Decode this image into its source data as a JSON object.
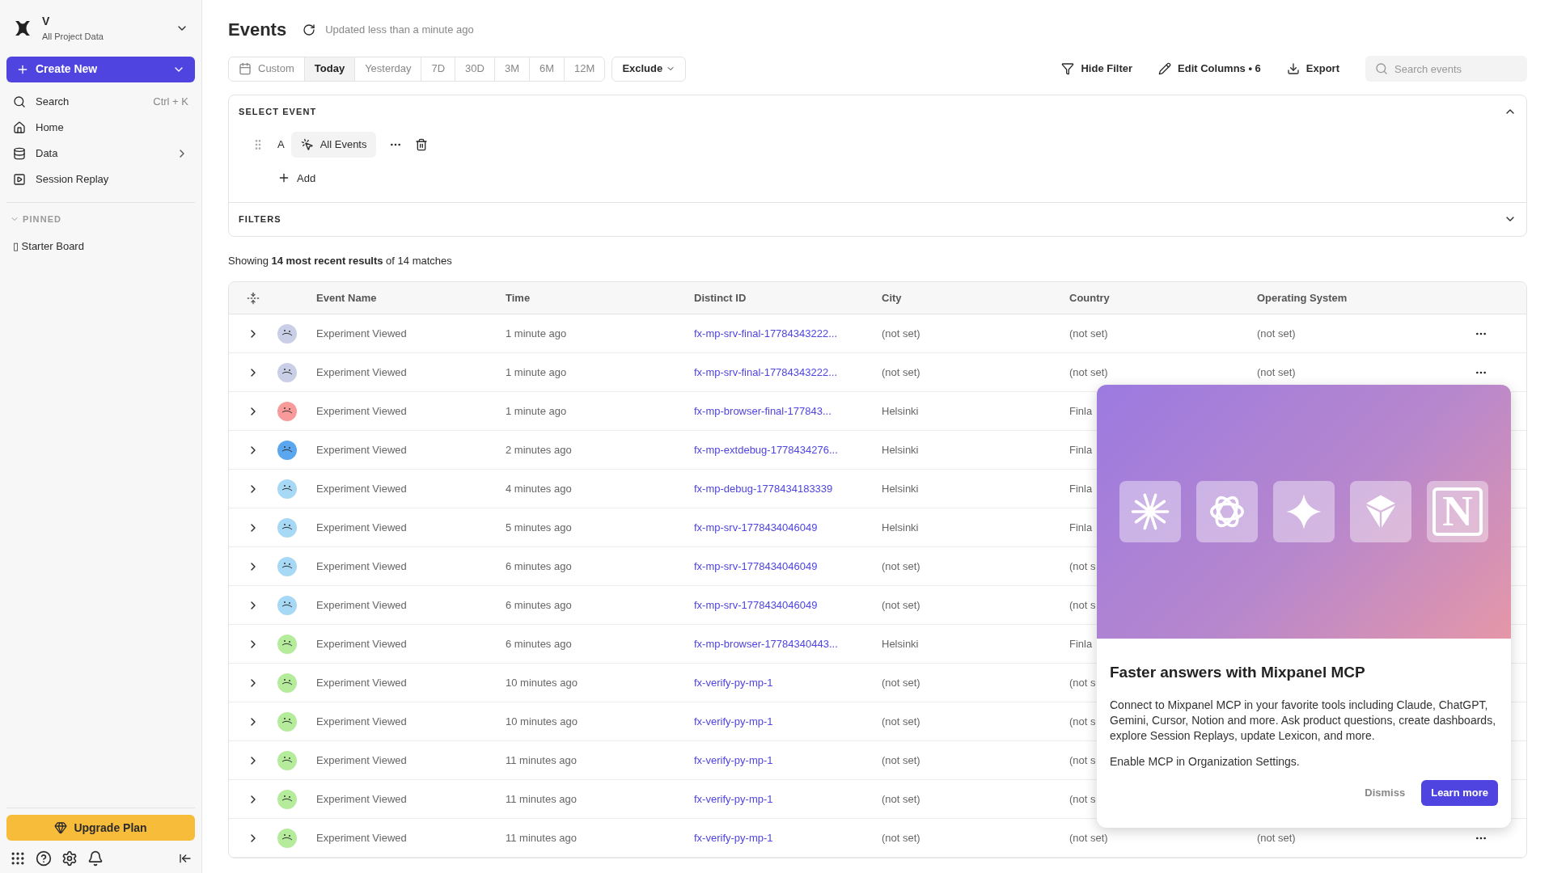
{
  "sidebar": {
    "project": {
      "name": "V",
      "subtitle": "All Project Data"
    },
    "create_button": "Create New",
    "nav": [
      {
        "kind": "search",
        "label": "Search",
        "shortcut": "Ctrl + K"
      },
      {
        "kind": "home",
        "label": "Home"
      },
      {
        "kind": "data",
        "label": "Data"
      },
      {
        "kind": "replay",
        "label": "Session Replay"
      }
    ],
    "pinned_heading": "PINNED",
    "pinned": [
      {
        "label": "▯ Starter Board"
      }
    ],
    "upgrade_button": "Upgrade Plan"
  },
  "header": {
    "title": "Events",
    "updated": "Updated less than a minute ago"
  },
  "range_tabs": [
    {
      "label": "Custom",
      "selected": false
    },
    {
      "label": "Today",
      "selected": true
    },
    {
      "label": "Yesterday",
      "selected": false
    },
    {
      "label": "7D",
      "selected": false
    },
    {
      "label": "30D",
      "selected": false
    },
    {
      "label": "3M",
      "selected": false
    },
    {
      "label": "6M",
      "selected": false
    },
    {
      "label": "12M",
      "selected": false
    }
  ],
  "exclude_button": "Exclude",
  "actions": [
    {
      "kind": "filter",
      "label": "Hide Filter"
    },
    {
      "kind": "edit",
      "label": "Edit Columns • 6"
    },
    {
      "kind": "export",
      "label": "Export"
    }
  ],
  "search": {
    "placeholder": "Search events"
  },
  "select_event": {
    "heading": "SELECT EVENT",
    "expanded": true,
    "letter": "A",
    "event": "All Events",
    "add": "Add"
  },
  "filters": {
    "heading": "FILTERS",
    "expanded": false
  },
  "summary": "Showing **14 most recent results** of 14 matches",
  "table": {
    "columns": [
      "Event Name",
      "Time",
      "Distinct ID",
      "City",
      "Country",
      "Operating System"
    ],
    "rows": [
      {
        "color": "#c9cfe6",
        "event": "Experiment Viewed",
        "time": "1 minute ago",
        "distinct_id": "fx-mp-srv-final-17784343222...",
        "city": "(not set)",
        "country": "(not set)",
        "os": "(not set)",
        "menu": true
      },
      {
        "color": "#c9cfe6",
        "event": "Experiment Viewed",
        "time": "1 minute ago",
        "distinct_id": "fx-mp-srv-final-17784343222...",
        "city": "(not set)",
        "country": "(not set)",
        "os": "(not set)",
        "menu": true
      },
      {
        "color": "#f99a9a",
        "event": "Experiment Viewed",
        "time": "1 minute ago",
        "distinct_id": "fx-mp-browser-final-177843...",
        "city": "Helsinki",
        "country": "Finla"
      },
      {
        "color": "#5aa7f0",
        "event": "Experiment Viewed",
        "time": "2 minutes ago",
        "distinct_id": "fx-mp-extdebug-1778434276...",
        "city": "Helsinki",
        "country": "Finla"
      },
      {
        "color": "#a7d8f5",
        "event": "Experiment Viewed",
        "time": "4 minutes ago",
        "distinct_id": "fx-mp-debug-1778434183339",
        "city": "Helsinki",
        "country": "Finla"
      },
      {
        "color": "#a7d8f5",
        "event": "Experiment Viewed",
        "time": "5 minutes ago",
        "distinct_id": "fx-mp-srv-1778434046049",
        "city": "Helsinki",
        "country": "Finla"
      },
      {
        "color": "#a7d8f5",
        "event": "Experiment Viewed",
        "time": "6 minutes ago",
        "distinct_id": "fx-mp-srv-1778434046049",
        "city": "(not set)",
        "country": "(not s"
      },
      {
        "color": "#a7d8f5",
        "event": "Experiment Viewed",
        "time": "6 minutes ago",
        "distinct_id": "fx-mp-srv-1778434046049",
        "city": "(not set)",
        "country": "(not s"
      },
      {
        "color": "#b5ec9c",
        "event": "Experiment Viewed",
        "time": "6 minutes ago",
        "distinct_id": "fx-mp-browser-17784340443...",
        "city": "Helsinki",
        "country": "Finla"
      },
      {
        "color": "#b5ec9c",
        "event": "Experiment Viewed",
        "time": "10 minutes ago",
        "distinct_id": "fx-verify-py-mp-1",
        "city": "(not set)",
        "country": "(not s"
      },
      {
        "color": "#b5ec9c",
        "event": "Experiment Viewed",
        "time": "10 minutes ago",
        "distinct_id": "fx-verify-py-mp-1",
        "city": "(not set)",
        "country": "(not s"
      },
      {
        "color": "#b5ec9c",
        "event": "Experiment Viewed",
        "time": "11 minutes ago",
        "distinct_id": "fx-verify-py-mp-1",
        "city": "(not set)",
        "country": "(not s"
      },
      {
        "color": "#b5ec9c",
        "event": "Experiment Viewed",
        "time": "11 minutes ago",
        "distinct_id": "fx-verify-py-mp-1",
        "city": "(not set)",
        "country": "(not s"
      },
      {
        "color": "#b5ec9c",
        "event": "Experiment Viewed",
        "time": "11 minutes ago",
        "distinct_id": "fx-verify-py-mp-1",
        "city": "(not set)",
        "country": "(not set)",
        "os": "(not set)",
        "menu": true
      }
    ]
  },
  "promo": {
    "tiles": [
      {
        "kind": "starburst"
      },
      {
        "kind": "rings"
      },
      {
        "kind": "sparkle"
      },
      {
        "kind": "cube"
      },
      {
        "kind": "letter",
        "glyph": "N"
      }
    ],
    "title": "Faster answers with Mixpanel MCP",
    "body": "Connect to Mixpanel MCP in your favorite tools including Claude, ChatGPT, Gemini, Cursor, Notion and more. Ask product questions, create dashboards, explore Session Replays, update Lexicon, and more.",
    "note": "Enable MCP in Organization Settings.",
    "dismiss": "Dismiss",
    "learn_more": "Learn more"
  }
}
